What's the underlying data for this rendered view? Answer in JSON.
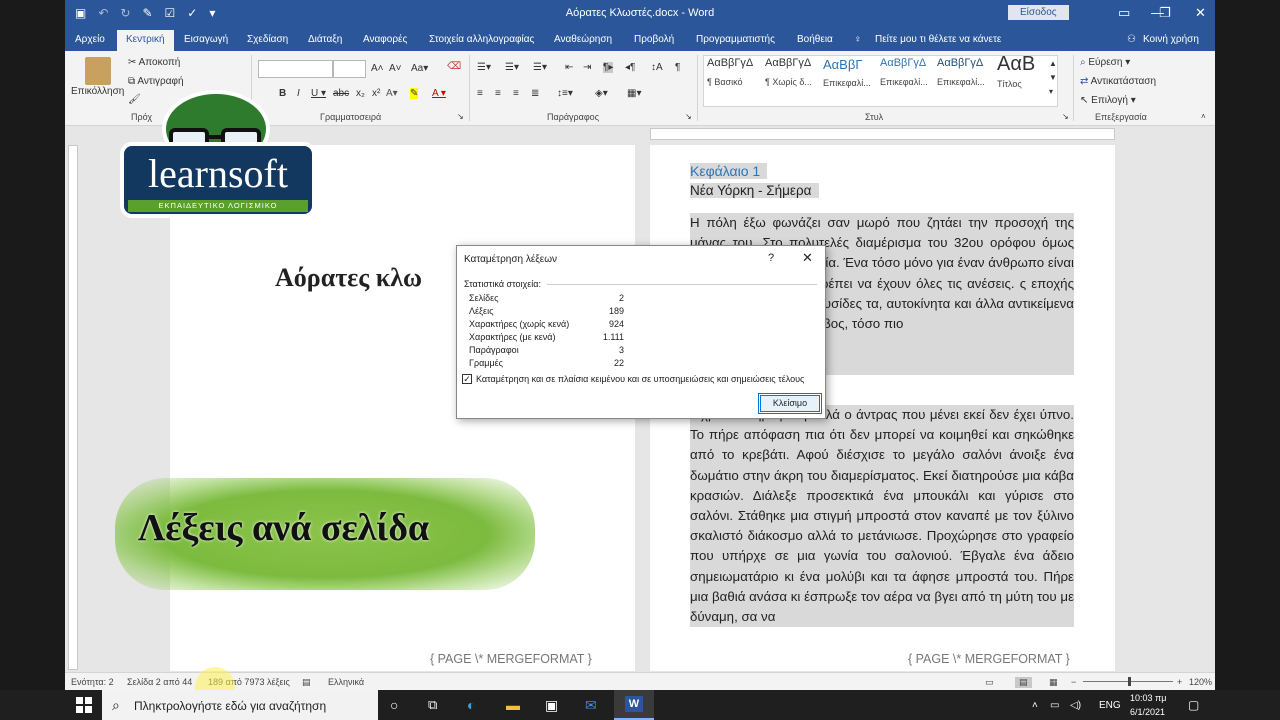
{
  "window": {
    "title": "Αόρατες Κλωστές.docx - Word",
    "signin": "Είσοδος"
  },
  "tabs": [
    "Αρχείο",
    "Κεντρική",
    "Εισαγωγή",
    "Σχεδίαση",
    "Διάταξη",
    "Αναφορές",
    "Στοιχεία αλληλογραφίας",
    "Αναθεώρηση",
    "Προβολή",
    "Προγραμματιστής",
    "Βοήθεια"
  ],
  "tell_me": "Πείτε μου τι θέλετε να κάνετε",
  "share": "Κοινή χρήση",
  "ribbon": {
    "clipboard": {
      "paste": "Επικόλληση",
      "cut": "Αποκοπή",
      "copy": "Αντιγραφή",
      "label": "Πρόχ"
    },
    "font_label": "Γραμματοσειρά",
    "paragraph_label": "Παράγραφος",
    "styles_label": "Στυλ",
    "editing_label": "Επεξεργασία",
    "styles": [
      {
        "preview": "ΑαΒβΓγΔ",
        "name": "¶ Βασικό"
      },
      {
        "preview": "ΑαΒβΓγΔ",
        "name": "¶ Χωρίς δ..."
      },
      {
        "preview": "ΑαΒβΓ",
        "name": "Επικεφαλί..."
      },
      {
        "preview": "ΑαΒβΓγΔ",
        "name": "Επικεφαλί..."
      },
      {
        "preview": "ΑαΒβΓγΔ",
        "name": "Επικεφαλί..."
      },
      {
        "preview": "ΑαΒ",
        "name": "Τίτλος"
      }
    ],
    "editing": {
      "find": "Εύρεση",
      "replace": "Αντικατάσταση",
      "select": "Επιλογή"
    }
  },
  "page1": {
    "title": "Αόρατες κλω",
    "field": "{ PAGE \\* MERGEFORMAT }"
  },
  "page2": {
    "heading": "Κεφάλαιο 1",
    "subtitle": "Νέα Υόρκη - Σήμερα",
    "para1": "Η πόλη έξω φωνάζει σαν μωρό που ζητάει την προσοχή της μάνας του. Στο πολυτελές διαμέρισμα του 32ου ορόφου όμως απ' όλη αυτή τη φασαρία. Ένα τόσο μόνο για έναν άνθρωπο είναι υπερβολή, φυλακές πρέπει να έχουν όλες τις ανέσεις. ς εποχής δεν είναι δεμένοι με αλυσίδες τα, αυτοκίνητα και άλλα αντικείμενα πιο σημαντικός ο σκλάβος, τόσο πιο",
    "para2": "ν χρυσοπληρωμένη αλλά ο άντρας που μένει εκεί δεν έχει ύπνο. Το πήρε απόφαση πια ότι δεν μπορεί να κοιμηθεί και σηκώθηκε από το κρεβάτι. Αφού διέσχισε το μεγάλο σαλόνι άνοιξε ένα δωμάτιο στην άκρη του διαμερίσματος. Εκεί διατηρούσε μια κάβα κρασιών. Διάλεξε προσεκτικά ένα μπουκάλι και γύρισε στο σαλόνι. Στάθηκε μια στιγμή μπροστά στον καναπέ με τον ξύλινο σκαλιστό διάκοσμο αλλά το μετάνιωσε. Προχώρησε στο γραφείο που υπήρχε σε μια γωνία του σαλονιού. Έβγαλε ένα άδειο σημειωματάριο κι ένα μολύβι και τα άφησε μπροστά του. Πήρε μια βαθιά ανάσα κι έσπρωξε τον αέρα να βγει από τη μύτη του με δύναμη, σα να",
    "field": "{ PAGE \\* MERGEFORMAT }"
  },
  "dialog": {
    "title": "Καταμέτρηση λέξεων",
    "help": "?",
    "section": "Στατιστικά στοιχεία:",
    "stats": [
      {
        "label": "Σελίδες",
        "value": "2"
      },
      {
        "label": "Λέξεις",
        "value": "189"
      },
      {
        "label": "Χαρακτήρες (χωρίς κενά)",
        "value": "924"
      },
      {
        "label": "Χαρακτήρες (με κενά)",
        "value": "1.111"
      },
      {
        "label": "Παράγραφοι",
        "value": "3"
      },
      {
        "label": "Γραμμές",
        "value": "22"
      }
    ],
    "checkbox_label": "Καταμέτρηση και σε πλαίσια κειμένου και σε υποσημειώσεις και σημειώσεις τέλους",
    "checked": true,
    "close": "Κλείσιμο"
  },
  "overlay": {
    "logo_name": "learnsoft",
    "logo_tag": "ΕΚΠΑΙΔΕΥΤΙΚΟ ΛΟΓΙΣΜΙΚΟ",
    "promo": "Λέξεις ανά σελίδα"
  },
  "statusbar": {
    "section": "Ενότητα: 2",
    "page": "Σελίδα 2 από 44",
    "words": "189 από 7973 λέξεις",
    "language": "Ελληνικά",
    "zoom": "120%"
  },
  "taskbar": {
    "search_placeholder": "Πληκτρολογήστε εδώ για αναζήτηση",
    "lang": "ENG",
    "time": "10:03 πμ",
    "date": "6/1/2021"
  }
}
